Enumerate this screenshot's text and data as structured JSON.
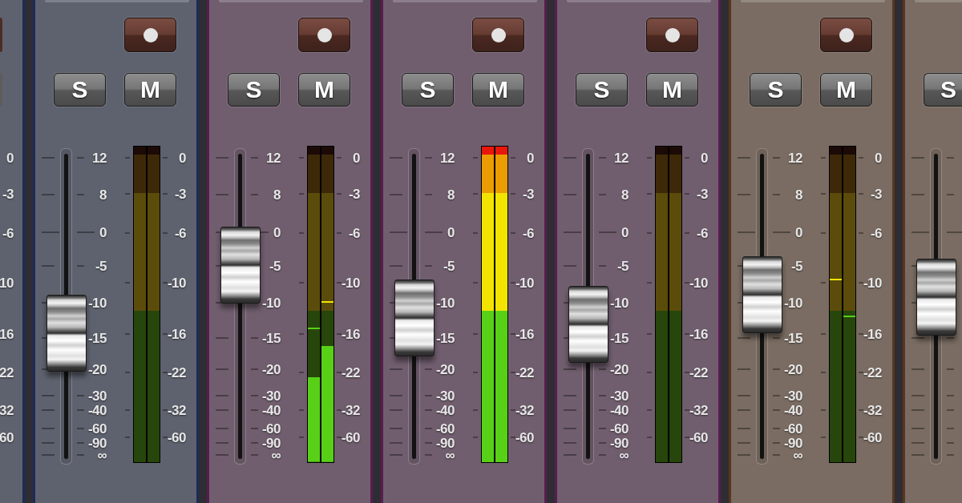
{
  "strips": [
    {
      "kind": "partial_left",
      "color": "#5e626e",
      "meter": {
        "scale": [
          "0",
          "-3",
          "-6",
          "10",
          "16",
          "22",
          "32",
          "60"
        ]
      }
    },
    {
      "kind": "full",
      "color": "#5e626e",
      "buttons": [
        "S",
        "M"
      ],
      "fader": {
        "level": 0.41,
        "scale": [
          "12",
          "8",
          "0",
          "-5",
          "-10",
          "-15",
          "-20",
          "-30",
          "-40",
          "-60",
          "-90",
          "∞"
        ]
      },
      "meter": {
        "channels": [
          {
            "clip": false
          },
          {
            "clip": false
          }
        ],
        "scale": [
          "0",
          "-3",
          "-6",
          "-10",
          "-16",
          "-22",
          "-32",
          "-60"
        ]
      }
    },
    {
      "kind": "full",
      "color": "#705e6e",
      "buttons": [
        "S",
        "M"
      ],
      "fader": {
        "level": 0.64,
        "scale": [
          "12",
          "8",
          "0",
          "-5",
          "-10",
          "-15",
          "-20",
          "-30",
          "-40",
          "-60",
          "-90",
          "∞"
        ]
      },
      "meter": {
        "channels": [
          {
            "level": 0.275,
            "clip": false,
            "peak_hold": {
              "level": 0.436
            }
          },
          {
            "level": 0.377,
            "clip": false,
            "peak_hold": {
              "level": 0.522
            }
          }
        ],
        "scale": [
          "0",
          "-3",
          "-6",
          "-10",
          "-16",
          "-22",
          "-32",
          "-60"
        ]
      }
    },
    {
      "kind": "full",
      "color": "#705e6e",
      "buttons": [
        "S",
        "M"
      ],
      "fader": {
        "level": 0.46,
        "scale": [
          "12",
          "8",
          "0",
          "-5",
          "-10",
          "-15",
          "-20",
          "-30",
          "-40",
          "-60",
          "-90",
          "∞"
        ]
      },
      "meter": {
        "channels": [
          {
            "level": 1,
            "clip": true
          },
          {
            "level": 1,
            "clip": true
          }
        ],
        "scale": [
          "0",
          "-3",
          "-6",
          "-10",
          "-16",
          "-22",
          "-32",
          "-60"
        ]
      }
    },
    {
      "kind": "full",
      "color": "#705e6e",
      "buttons": [
        "S",
        "M"
      ],
      "fader": {
        "level": 0.44,
        "scale": [
          "12",
          "8",
          "0",
          "-5",
          "-10",
          "-15",
          "-20",
          "-30",
          "-40",
          "-60",
          "-90",
          "∞"
        ]
      },
      "meter": {
        "channels": [
          {
            "clip": false
          },
          {
            "clip": false
          }
        ],
        "scale": [
          "0",
          "-3",
          "-6",
          "-10",
          "-16",
          "-22",
          "-32",
          "-60"
        ]
      }
    },
    {
      "kind": "full",
      "color": "#7a6c62",
      "buttons": [
        "S",
        "M"
      ],
      "fader": {
        "level": 0.54,
        "scale": [
          "12",
          "8",
          "0",
          "-5",
          "-10",
          "-15",
          "-20",
          "-30",
          "-40",
          "-60",
          "-90",
          "∞"
        ]
      },
      "meter": {
        "channels": [
          {
            "clip": false,
            "peak_hold": {
              "level": 0.595
            }
          },
          {
            "clip": false,
            "peak_hold": {
              "level": 0.473
            }
          }
        ],
        "scale": [
          "0",
          "-3",
          "-6",
          "-10",
          "-16",
          "-22",
          "-32",
          "-60"
        ]
      }
    },
    {
      "kind": "partial_right",
      "color": "#7a6c62",
      "buttons": [
        "S"
      ],
      "fader": {
        "level": 0.53
      }
    }
  ]
}
